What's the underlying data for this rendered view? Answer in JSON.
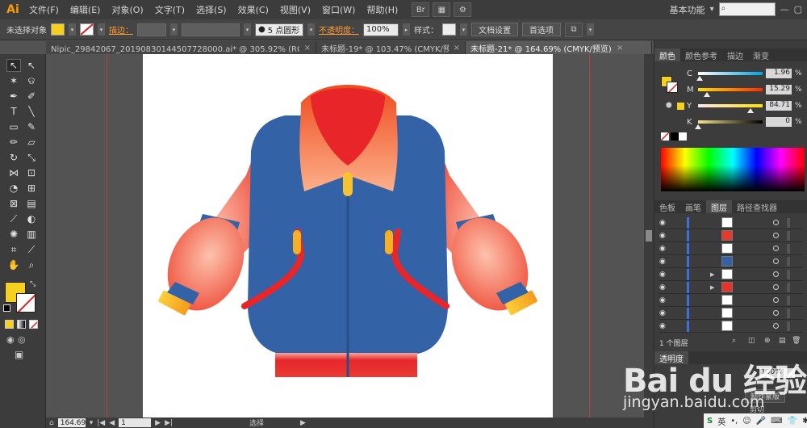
{
  "app": {
    "logo": "Ai",
    "menu": [
      "文件(F)",
      "编辑(E)",
      "对象(O)",
      "文字(T)",
      "选择(S)",
      "效果(C)",
      "视图(V)",
      "窗口(W)",
      "帮助(H)"
    ],
    "workspace": "基本功能",
    "workspace_arrow": "▾",
    "search_placeholder": ""
  },
  "controlbar": {
    "selection_label": "未选择对象",
    "fill_color": "#f5d01f",
    "stroke_label": "描边：",
    "brush_label": "5 点圆形",
    "opacity_label": "不透明度：",
    "opacity_value": "100%",
    "style_label": "样式：",
    "doc_settings": "文档设置",
    "preferences": "首选项"
  },
  "tabs": [
    {
      "label": "Nipic_29842067_20190830144507728000.ai* @ 305.92% (RGB/预…",
      "close": "×",
      "active": false
    },
    {
      "label": "未标题-19* @ 103.47% (CMYK/预…",
      "close": "×",
      "active": false
    },
    {
      "label": "未标题-21* @ 164.69% (CMYK/预览)",
      "close": "×",
      "active": true
    }
  ],
  "tools": [
    {
      "name": "selection-tool",
      "glyph": "↖"
    },
    {
      "name": "direct-selection-tool",
      "glyph": "↖"
    },
    {
      "name": "magic-wand-tool",
      "glyph": "✶"
    },
    {
      "name": "lasso-tool",
      "glyph": "ଡ"
    },
    {
      "name": "pen-tool",
      "glyph": "✒"
    },
    {
      "name": "curvature-tool",
      "glyph": "✐"
    },
    {
      "name": "type-tool",
      "glyph": "T"
    },
    {
      "name": "line-tool",
      "glyph": "╲"
    },
    {
      "name": "rectangle-tool",
      "glyph": "▭"
    },
    {
      "name": "paintbrush-tool",
      "glyph": "✎"
    },
    {
      "name": "pencil-tool",
      "glyph": "✏"
    },
    {
      "name": "eraser-tool",
      "glyph": "▱"
    },
    {
      "name": "rotate-tool",
      "glyph": "↻"
    },
    {
      "name": "scale-tool",
      "glyph": "⤡"
    },
    {
      "name": "width-tool",
      "glyph": "⋈"
    },
    {
      "name": "free-transform-tool",
      "glyph": "⊡"
    },
    {
      "name": "shape-builder-tool",
      "glyph": "◔"
    },
    {
      "name": "perspective-grid-tool",
      "glyph": "⊞"
    },
    {
      "name": "mesh-tool",
      "glyph": "⊠"
    },
    {
      "name": "gradient-tool",
      "glyph": "▤"
    },
    {
      "name": "eyedropper-tool",
      "glyph": "⟋"
    },
    {
      "name": "blend-tool",
      "glyph": "◐"
    },
    {
      "name": "symbol-sprayer-tool",
      "glyph": "✺"
    },
    {
      "name": "column-graph-tool",
      "glyph": "▥"
    },
    {
      "name": "artboard-tool",
      "glyph": "⌗"
    },
    {
      "name": "slice-tool",
      "glyph": "⟋"
    },
    {
      "name": "hand-tool",
      "glyph": "✋"
    },
    {
      "name": "zoom-tool",
      "glyph": "⌕"
    }
  ],
  "toolbox_colors": {
    "fill": "#f5d01f",
    "stroke": "none"
  },
  "status": {
    "zoom": "164.69",
    "page": "1",
    "mode": "选择"
  },
  "color_panel": {
    "tabs": [
      "颜色",
      "颜色参考",
      "描边",
      "渐变"
    ],
    "channels": [
      {
        "label": "C",
        "value": "1.96",
        "level": 0.02,
        "gradient": "linear-gradient(to right,#fff,#00a0e0)"
      },
      {
        "label": "M",
        "value": "15.29",
        "level": 0.15,
        "gradient": "linear-gradient(to right,#ffe000,#ff2a00)"
      },
      {
        "label": "Y",
        "value": "84.71",
        "level": 0.85,
        "gradient": "linear-gradient(to right,#ffe6f0,#ffe000)"
      },
      {
        "label": "K",
        "value": "0",
        "level": 0.0,
        "gradient": "linear-gradient(to right,#f6e48a,#000)"
      }
    ],
    "pct": "%"
  },
  "layers_panel": {
    "tabs": [
      "色板",
      "画笔",
      "图层",
      "路径查找器"
    ],
    "footer": "1 个图层",
    "rows": [
      {
        "thumb": "#ffffff",
        "expand": ""
      },
      {
        "thumb": "#e83a2a",
        "expand": ""
      },
      {
        "thumb": "#ffffff",
        "expand": ""
      },
      {
        "thumb": "#3363a6",
        "expand": ""
      },
      {
        "thumb": "#ffffff",
        "expand": "▶"
      },
      {
        "thumb": "#e8322a",
        "expand": "▶"
      },
      {
        "thumb": "#ffffff",
        "expand": ""
      },
      {
        "thumb": "#ffffff",
        "expand": ""
      },
      {
        "thumb": "#ffffff",
        "expand": ""
      }
    ]
  },
  "lower_panel": {
    "tab": "透明度",
    "opacity_value": "100%",
    "button1": "制作蒙版",
    "button2": "剪切"
  },
  "watermark": {
    "brand": "Bai du 经验",
    "url": "jingyan.baidu.com"
  },
  "ime": {
    "label": "英"
  },
  "jacket": {
    "body": "#3363a6",
    "accent": "#e8262a",
    "sleeve": "#f06a58",
    "cuff": "#f7b024",
    "button": "#f7c230"
  }
}
